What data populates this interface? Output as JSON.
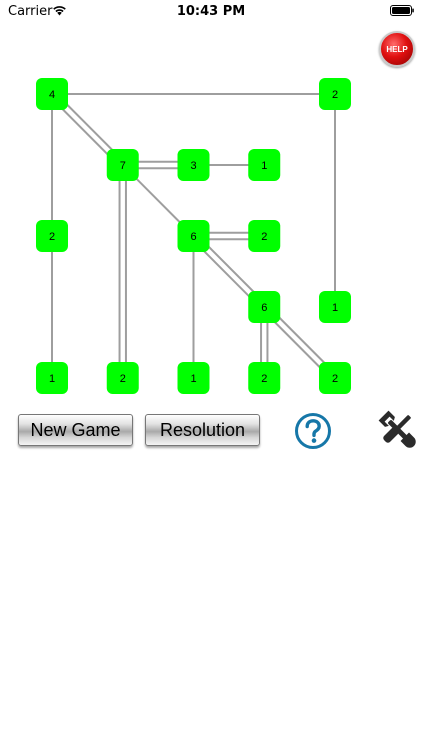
{
  "status_bar": {
    "carrier": "Carrier",
    "time": "10:43 PM",
    "wifi_icon": "wifi-icon",
    "battery_icon": "battery-icon"
  },
  "help_button": {
    "label": "HELP"
  },
  "board": {
    "columns": 5,
    "rows": 5,
    "island_color": "#00ff00",
    "bridge_color": "#9e9e9e",
    "islands": [
      {
        "id": "a",
        "col": 0,
        "row": 0,
        "value": "4"
      },
      {
        "id": "b",
        "col": 4,
        "row": 0,
        "value": "2"
      },
      {
        "id": "c",
        "col": 1,
        "row": 1,
        "value": "7"
      },
      {
        "id": "d",
        "col": 2,
        "row": 1,
        "value": "3"
      },
      {
        "id": "e",
        "col": 3,
        "row": 1,
        "value": "1"
      },
      {
        "id": "f",
        "col": 0,
        "row": 2,
        "value": "2"
      },
      {
        "id": "g",
        "col": 2,
        "row": 2,
        "value": "6"
      },
      {
        "id": "h",
        "col": 3,
        "row": 2,
        "value": "2"
      },
      {
        "id": "i",
        "col": 3,
        "row": 3,
        "value": "6"
      },
      {
        "id": "j",
        "col": 4,
        "row": 3,
        "value": "1"
      },
      {
        "id": "k",
        "col": 0,
        "row": 4,
        "value": "1"
      },
      {
        "id": "l",
        "col": 1,
        "row": 4,
        "value": "2"
      },
      {
        "id": "m",
        "col": 2,
        "row": 4,
        "value": "1"
      },
      {
        "id": "n",
        "col": 3,
        "row": 4,
        "value": "2"
      },
      {
        "id": "o",
        "col": 4,
        "row": 4,
        "value": "2"
      }
    ],
    "bridges": [
      {
        "from": "a",
        "to": "b",
        "count": 1
      },
      {
        "from": "a",
        "to": "f",
        "count": 1
      },
      {
        "from": "a",
        "to": "c",
        "count": 2
      },
      {
        "from": "b",
        "to": "j",
        "count": 1
      },
      {
        "from": "c",
        "to": "d",
        "count": 2
      },
      {
        "from": "d",
        "to": "e",
        "count": 1
      },
      {
        "from": "c",
        "to": "l",
        "count": 2
      },
      {
        "from": "c",
        "to": "g",
        "count": 1
      },
      {
        "from": "f",
        "to": "k",
        "count": 1
      },
      {
        "from": "g",
        "to": "h",
        "count": 2
      },
      {
        "from": "g",
        "to": "m",
        "count": 1
      },
      {
        "from": "g",
        "to": "i",
        "count": 2
      },
      {
        "from": "i",
        "to": "n",
        "count": 2
      },
      {
        "from": "i",
        "to": "o",
        "count": 2
      }
    ]
  },
  "controls": {
    "new_game_label": "New Game",
    "resolution_label": "Resolution",
    "question_icon": "question-icon",
    "tools_icon": "tools-icon",
    "accent_color": "#1677a8"
  }
}
